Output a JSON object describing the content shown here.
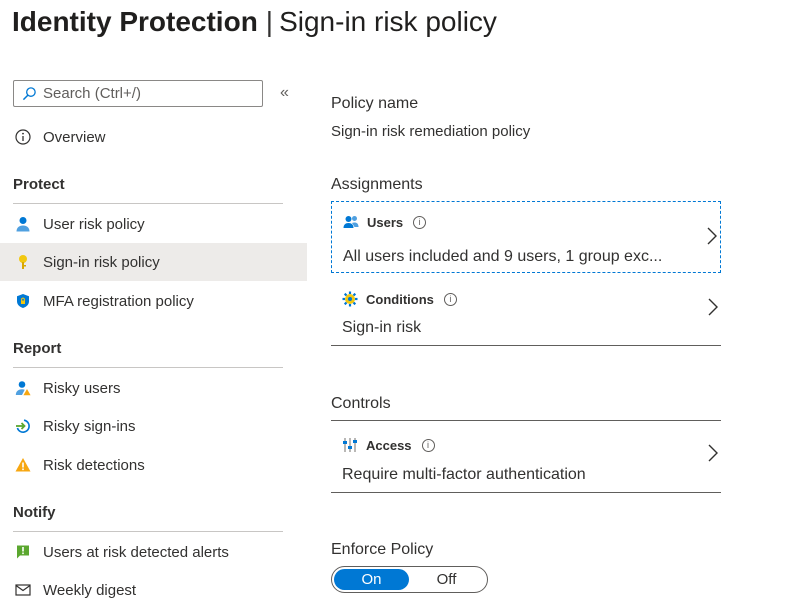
{
  "header": {
    "title_bold": "Identity Protection",
    "separator": "|",
    "title_rest": "Sign-in risk policy"
  },
  "sidebar": {
    "search_placeholder": "Search (Ctrl+/)",
    "collapse_glyph": "«",
    "overview": "Overview",
    "sections": [
      {
        "label": "Protect",
        "items": [
          "User risk policy",
          "Sign-in risk policy",
          "MFA registration policy"
        ]
      },
      {
        "label": "Report",
        "items": [
          "Risky users",
          "Risky sign-ins",
          "Risk detections"
        ]
      },
      {
        "label": "Notify",
        "items": [
          "Users at risk detected alerts",
          "Weekly digest"
        ]
      }
    ],
    "selected_item": "Sign-in risk policy"
  },
  "main": {
    "policy_name_label": "Policy name",
    "policy_name_value": "Sign-in risk remediation policy",
    "assignments_label": "Assignments",
    "users": {
      "title": "Users",
      "info": "i",
      "summary": "All users included and 9 users, 1 group exc..."
    },
    "conditions": {
      "title": "Conditions",
      "info": "i",
      "summary": "Sign-in risk"
    },
    "controls_label": "Controls",
    "access": {
      "title": "Access",
      "info": "i",
      "summary": "Require multi-factor authentication"
    },
    "enforce_label": "Enforce Policy",
    "toggle": {
      "on_label": "On",
      "off_label": "Off",
      "value": "On"
    }
  },
  "colors": {
    "accent": "#0078d4",
    "selected_bg": "#edebe9",
    "warning": "#f7a711",
    "alert_green": "#5ba72f"
  },
  "icons": {
    "search": "search-icon",
    "overview": "info-circle-icon",
    "user_risk": "user-icon",
    "signin_risk": "key-icon",
    "mfa": "shield-icon",
    "risky_users": "risky-user-icon",
    "risky_signins": "signin-arrow-icon",
    "risk_detections": "warning-icon",
    "alerts": "alert-flag-icon",
    "digest": "mail-icon",
    "users_row": "users-icon",
    "conditions_row": "gear-icon",
    "access_row": "sliders-icon",
    "chevron": "chevron-right-icon"
  }
}
